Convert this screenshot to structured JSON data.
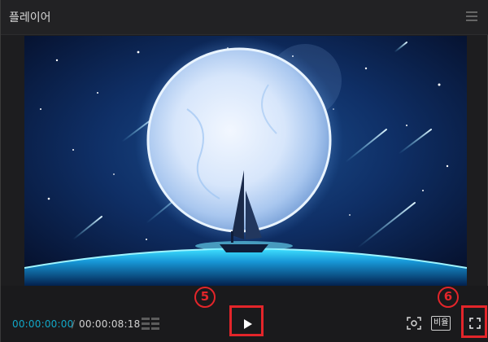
{
  "window": {
    "title": "플레이어"
  },
  "player": {
    "current_time": "00:00:00:00",
    "separator": "/",
    "total_time": "00:00:08:18",
    "ratio_label": "비율"
  },
  "annotations": {
    "play_marker": "5",
    "fullscreen_marker": "6"
  },
  "icons": [
    "menu-icon",
    "grid-icon",
    "play-icon",
    "capture-icon",
    "fullscreen-icon"
  ],
  "colors": {
    "accent_time": "#12a7c7",
    "highlight": "#e3252a",
    "background": "#1d1d1f"
  }
}
